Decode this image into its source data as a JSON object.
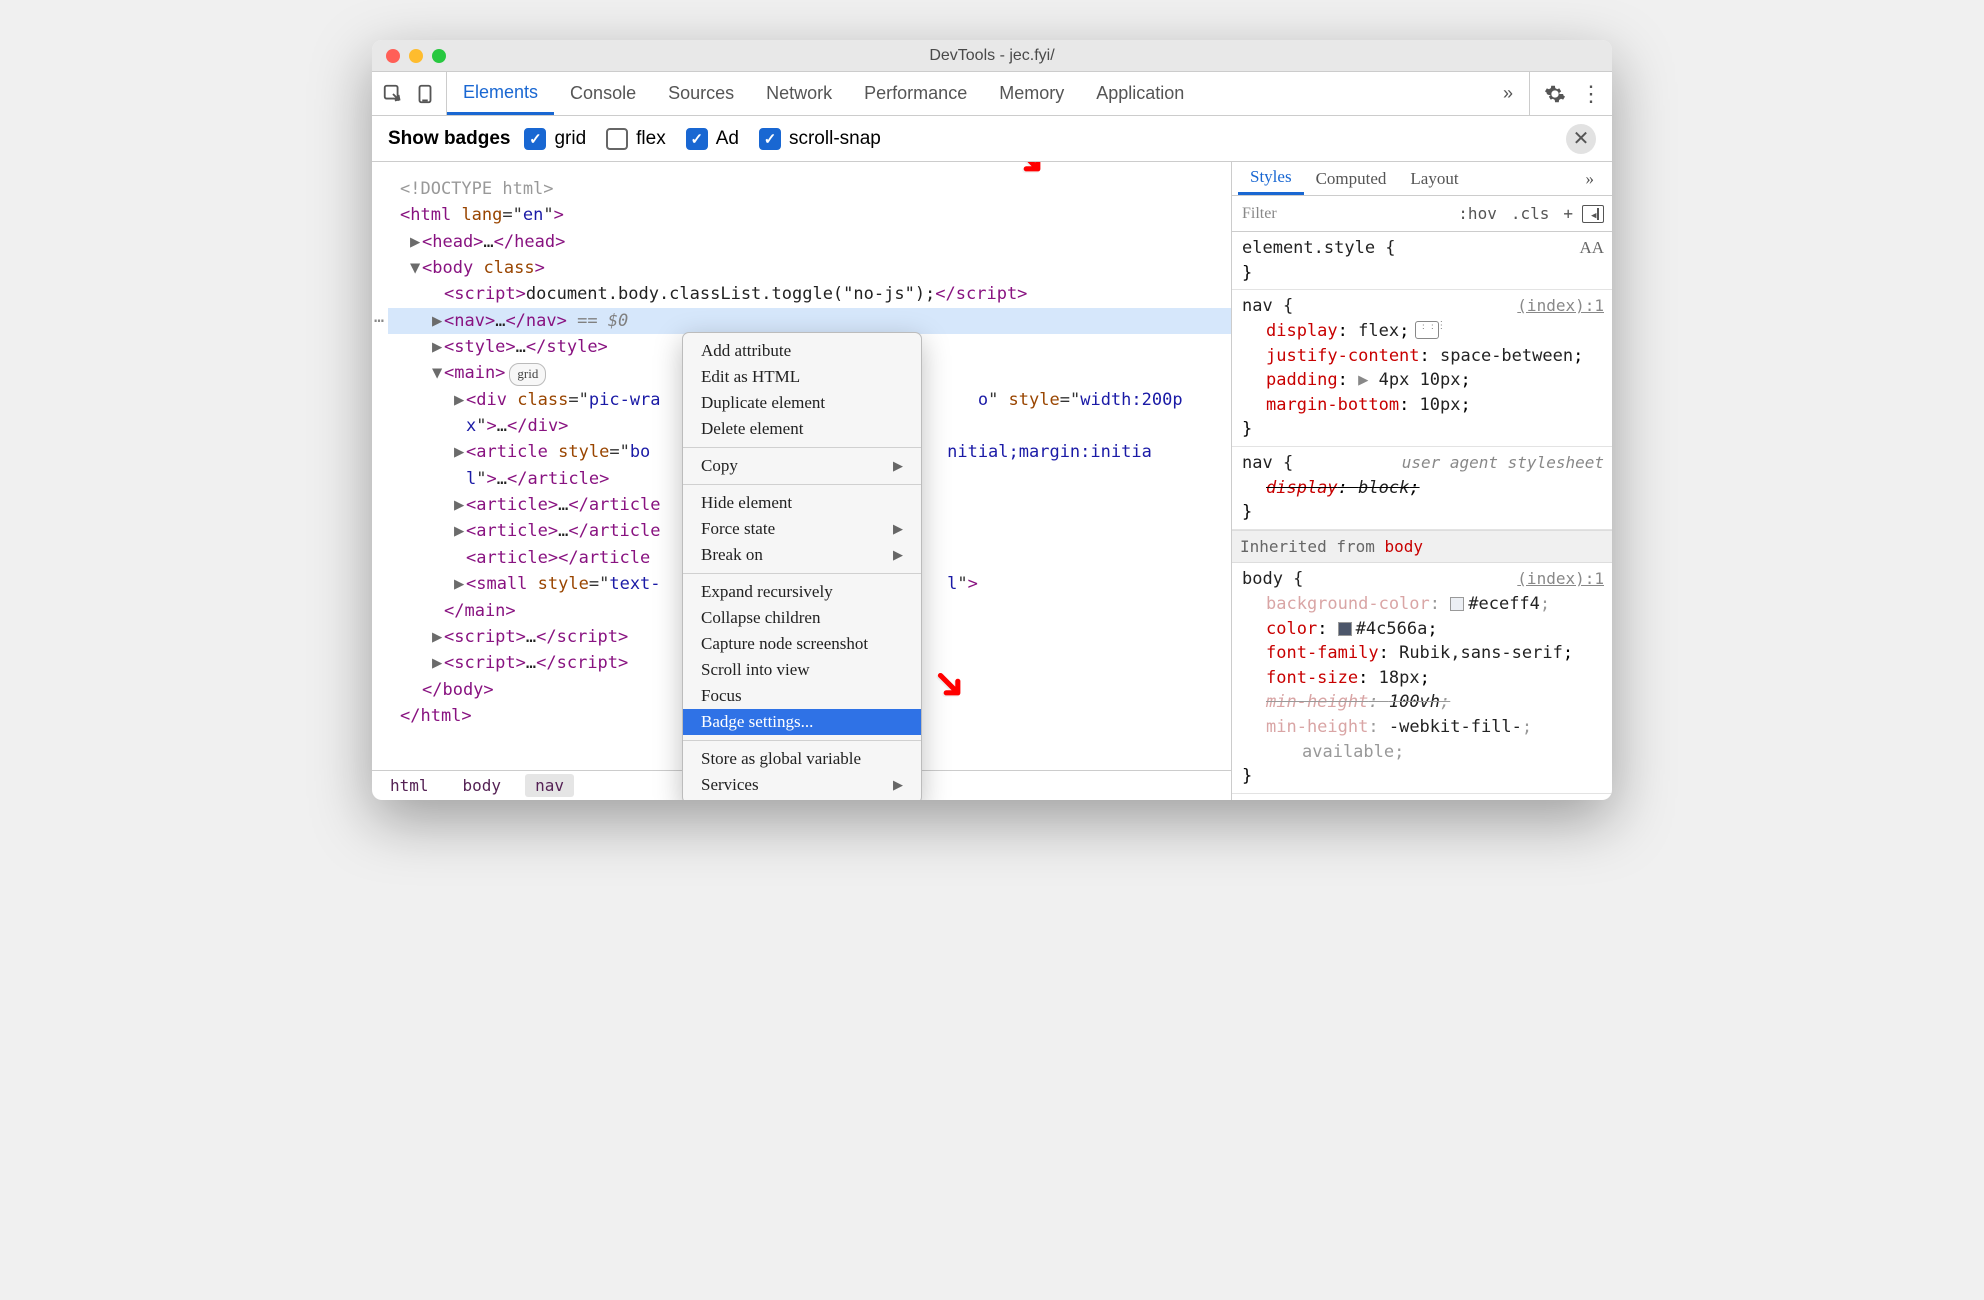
{
  "window": {
    "title": "DevTools - jec.fyi/"
  },
  "tabs": {
    "items": [
      "Elements",
      "Console",
      "Sources",
      "Network",
      "Performance",
      "Memory",
      "Application"
    ],
    "active": 0,
    "overflow_icon": "»"
  },
  "badgebar": {
    "label": "Show badges",
    "options": [
      {
        "label": "grid",
        "checked": true
      },
      {
        "label": "flex",
        "checked": false
      },
      {
        "label": "Ad",
        "checked": true
      },
      {
        "label": "scroll-snap",
        "checked": true
      }
    ]
  },
  "dom": {
    "lines": [
      {
        "indent": 1,
        "tri": "",
        "html": "<span class='comment'>&lt;!DOCTYPE html&gt;</span>"
      },
      {
        "indent": 1,
        "tri": "",
        "html": "<span class='tag'>&lt;html</span> <span class='attr'>lang</span>=\"<span class='val'>en</span>\"<span class='tag'>&gt;</span>"
      },
      {
        "indent": 2,
        "tri": "▶",
        "html": "<span class='tag'>&lt;head&gt;</span><span class='txt'>…</span><span class='tag'>&lt;/head&gt;</span>"
      },
      {
        "indent": 2,
        "tri": "▼",
        "html": "<span class='tag'>&lt;body</span> <span class='attr'>class</span><span class='tag'>&gt;</span>"
      },
      {
        "indent": 3,
        "tri": "",
        "html": "<span class='tag'>&lt;script&gt;</span><span class='js'>document.body.classList.toggle(\"no-js\");</span><span class='tag'>&lt;/script&gt;</span>"
      },
      {
        "indent": 3,
        "tri": "▶",
        "sel": true,
        "dots": true,
        "html": "<span class='tag'>&lt;nav&gt;</span><span class='txt'>…</span><span class='tag'>&lt;/nav&gt;</span> <span class='eq0'>== $0</span>"
      },
      {
        "indent": 3,
        "tri": "▶",
        "html": "<span class='tag'>&lt;style&gt;</span><span class='txt'>…</span><span class='tag'>&lt;/style&gt;</span>"
      },
      {
        "indent": 3,
        "tri": "▼",
        "html": "<span class='tag'>&lt;main&gt;</span><span class='gridbadge'>grid</span>"
      },
      {
        "indent": 4,
        "tri": "▶",
        "html": "<span class='tag'>&lt;div</span> <span class='attr'>class</span>=\"<span class='val'>pic-wra</span>&nbsp;&nbsp;&nbsp;&nbsp;&nbsp;&nbsp;&nbsp;&nbsp;&nbsp;&nbsp;&nbsp;&nbsp;&nbsp;&nbsp;&nbsp;&nbsp;&nbsp;&nbsp;&nbsp;&nbsp;&nbsp;&nbsp;&nbsp;&nbsp;&nbsp;&nbsp;&nbsp;&nbsp;&nbsp;&nbsp;&nbsp;<span class='val'>o</span>\" <span class='attr'>style</span>=\"<span class='val'>width:200p</span>"
      },
      {
        "indent": 4,
        "tri": "",
        "html": "<span class='val'>x</span>\"<span class='tag'>&gt;</span><span class='txt'>…</span><span class='tag'>&lt;/div&gt;</span>"
      },
      {
        "indent": 4,
        "tri": "▶",
        "html": "<span class='tag'>&lt;article</span> <span class='attr'>style</span>=\"<span class='val'>bo</span>&nbsp;&nbsp;&nbsp;&nbsp;&nbsp;&nbsp;&nbsp;&nbsp;&nbsp;&nbsp;&nbsp;&nbsp;&nbsp;&nbsp;&nbsp;&nbsp;&nbsp;&nbsp;&nbsp;&nbsp;&nbsp;&nbsp;&nbsp;&nbsp;&nbsp;&nbsp;&nbsp;&nbsp;&nbsp;<span class='val'>nitial;margin:initia</span>"
      },
      {
        "indent": 4,
        "tri": "",
        "html": "<span class='val'>l</span>\"<span class='tag'>&gt;</span><span class='txt'>…</span><span class='tag'>&lt;/article&gt;</span>"
      },
      {
        "indent": 4,
        "tri": "▶",
        "html": "<span class='tag'>&lt;article&gt;</span><span class='txt'>…</span><span class='tag'>&lt;/article</span>"
      },
      {
        "indent": 4,
        "tri": "▶",
        "html": "<span class='tag'>&lt;article&gt;</span><span class='txt'>…</span><span class='tag'>&lt;/article</span>"
      },
      {
        "indent": 4,
        "tri": "",
        "html": "<span class='tag'>&lt;article&gt;&lt;/article</span>"
      },
      {
        "indent": 4,
        "tri": "▶",
        "html": "<span class='tag'>&lt;small</span> <span class='attr'>style</span>=\"<span class='val'>text-</span>&nbsp;&nbsp;&nbsp;&nbsp;&nbsp;&nbsp;&nbsp;&nbsp;&nbsp;&nbsp;&nbsp;&nbsp;&nbsp;&nbsp;&nbsp;&nbsp;&nbsp;&nbsp;&nbsp;&nbsp;&nbsp;&nbsp;&nbsp;&nbsp;&nbsp;&nbsp;&nbsp;&nbsp;<span class='val'>l</span>\"<span class='tag'>&gt;</span>"
      },
      {
        "indent": 3,
        "tri": "",
        "html": "<span class='tag'>&lt;/main&gt;</span>"
      },
      {
        "indent": 3,
        "tri": "▶",
        "html": "<span class='tag'>&lt;script&gt;</span><span class='txt'>…</span><span class='tag'>&lt;/script&gt;</span>"
      },
      {
        "indent": 3,
        "tri": "▶",
        "html": "<span class='tag'>&lt;script&gt;</span><span class='txt'>…</span><span class='tag'>&lt;/script&gt;</span>"
      },
      {
        "indent": 2,
        "tri": "",
        "html": "<span class='tag'>&lt;/body&gt;</span>"
      },
      {
        "indent": 1,
        "tri": "",
        "html": "<span class='tag'>&lt;/html&gt;</span>"
      }
    ],
    "breadcrumb": [
      "html",
      "body",
      "nav"
    ],
    "breadcrumb_selected": 2
  },
  "contextmenu": {
    "groups": [
      [
        {
          "label": "Add attribute"
        },
        {
          "label": "Edit as HTML"
        },
        {
          "label": "Duplicate element"
        },
        {
          "label": "Delete element"
        }
      ],
      [
        {
          "label": "Copy",
          "sub": true
        }
      ],
      [
        {
          "label": "Hide element"
        },
        {
          "label": "Force state",
          "sub": true
        },
        {
          "label": "Break on",
          "sub": true
        }
      ],
      [
        {
          "label": "Expand recursively"
        },
        {
          "label": "Collapse children"
        },
        {
          "label": "Capture node screenshot"
        },
        {
          "label": "Scroll into view"
        },
        {
          "label": "Focus"
        },
        {
          "label": "Badge settings...",
          "hl": true
        }
      ],
      [
        {
          "label": "Store as global variable"
        },
        {
          "label": "Services",
          "sub": true
        }
      ]
    ]
  },
  "styles": {
    "tabs": [
      "Styles",
      "Computed",
      "Layout"
    ],
    "active": 0,
    "overflow": "»",
    "filter_placeholder": "Filter",
    "hov": ":hov",
    "cls": ".cls",
    "plus": "+",
    "element_style": {
      "selector": "element.style",
      "props": []
    },
    "rules": [
      {
        "selector": "nav",
        "source": "(index):1",
        "props": [
          {
            "name": "display",
            "value": "flex",
            "flexicon": true
          },
          {
            "name": "justify-content",
            "value": "space-between"
          },
          {
            "name": "padding",
            "value": "4px 10px",
            "expand": true
          },
          {
            "name": "margin-bottom",
            "value": "10px"
          }
        ]
      },
      {
        "selector": "nav",
        "source": "user agent stylesheet",
        "ua": true,
        "props": [
          {
            "name": "display",
            "value": "block",
            "strike": true
          }
        ]
      }
    ],
    "inherited_from": "body",
    "body_rule": {
      "selector": "body",
      "source": "(index):1",
      "props": [
        {
          "name": "background-color",
          "value": "#eceff4",
          "swatch": "#eceff4",
          "faded": true
        },
        {
          "name": "color",
          "value": "#4c566a",
          "swatch": "#4c566a"
        },
        {
          "name": "font-family",
          "value": "Rubik,sans-serif"
        },
        {
          "name": "font-size",
          "value": "18px"
        },
        {
          "name": "min-height",
          "value": "100vh",
          "strike": true,
          "faded": true
        },
        {
          "name": "min-height",
          "value": "-webkit-fill-",
          "faded": true
        },
        {
          "name": "",
          "value": "available;",
          "faded": true,
          "cont": true
        }
      ]
    },
    "aa_label": "AA"
  }
}
